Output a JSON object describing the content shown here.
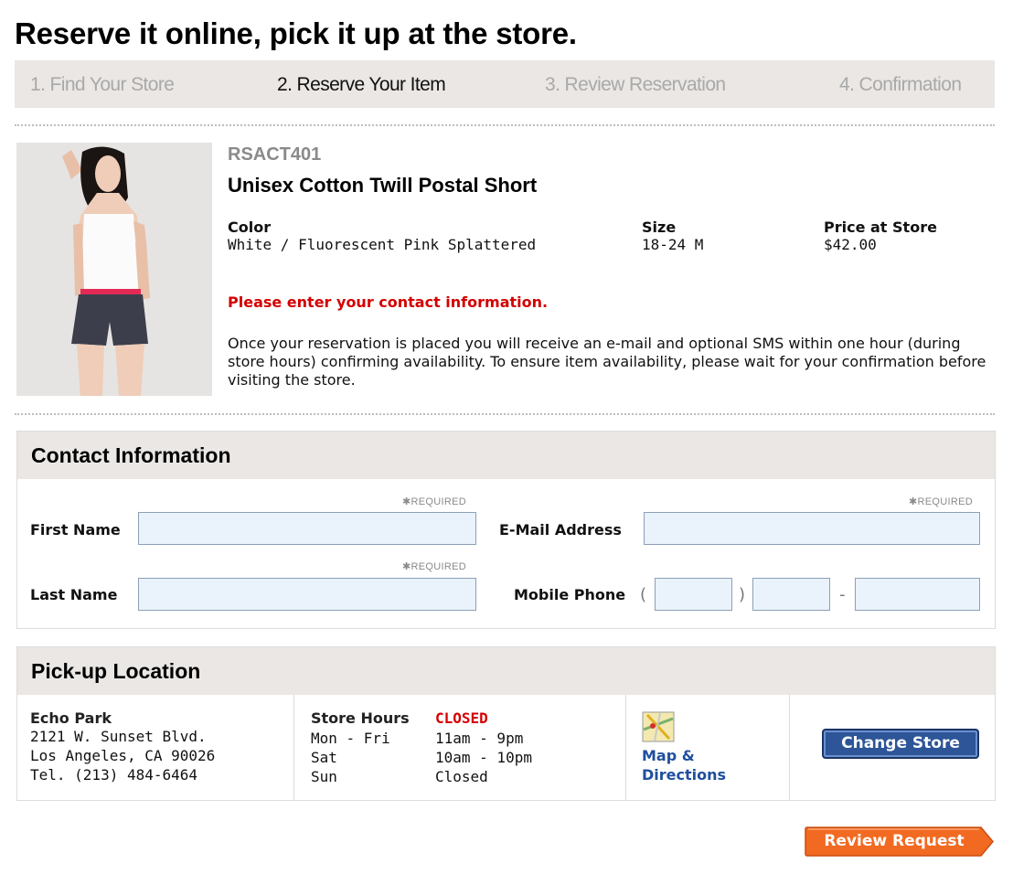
{
  "page": {
    "title": "Reserve it online, pick it up at the store."
  },
  "steps": [
    {
      "label": "1. Find Your Store",
      "active": false
    },
    {
      "label": "2. Reserve Your Item",
      "active": true
    },
    {
      "label": "3. Review Reservation",
      "active": false
    },
    {
      "label": "4. Confirmation",
      "active": false
    }
  ],
  "product": {
    "sku": "RSACT401",
    "name": "Unisex Cotton Twill Postal Short",
    "color_label": "Color",
    "color_value": "White / Fluorescent Pink Splattered",
    "size_label": "Size",
    "size_value": "18-24 M",
    "price_label": "Price at Store",
    "price_value": "$42.00",
    "error_message": "Please enter your contact information.",
    "info_text": "Once your reservation is placed you will receive an e-mail and optional SMS within one hour (during store hours) confirming availability. To ensure item availability, please wait for your confirmation before visiting the store."
  },
  "contact": {
    "heading": "Contact Information",
    "required_marker": "✱REQUIRED",
    "first_name_label": "First Name",
    "last_name_label": "Last Name",
    "email_label": "E-Mail Address",
    "mobile_label": "Mobile Phone",
    "paren_open": "(",
    "paren_close": ")",
    "dash": "-",
    "first_name_value": "",
    "last_name_value": "",
    "email_value": "",
    "phone_area_value": "",
    "phone_prefix_value": "",
    "phone_line_value": ""
  },
  "pickup": {
    "heading": "Pick-up Location",
    "store_name": "Echo Park",
    "address_line1": "2121 W. Sunset Blvd.",
    "address_line2": "Los Angeles, CA 90026",
    "phone": "Tel. (213) 484-6464",
    "hours_label": "Store Hours",
    "status": "CLOSED",
    "hours": [
      {
        "days": "Mon - Fri",
        "time": "11am - 9pm"
      },
      {
        "days": "Sat",
        "time": "10am - 10pm"
      },
      {
        "days": "Sun",
        "time": "Closed"
      }
    ],
    "map_link_line1": "Map &",
    "map_link_line2": "Directions",
    "change_store_label": "Change Store"
  },
  "actions": {
    "review_label": "Review Request"
  },
  "colors": {
    "accent_orange": "#f26a21",
    "button_blue": "#2d5597",
    "error_red": "#d40000",
    "link_blue": "#1f4f9e",
    "panel_gray": "#eae7e4"
  }
}
